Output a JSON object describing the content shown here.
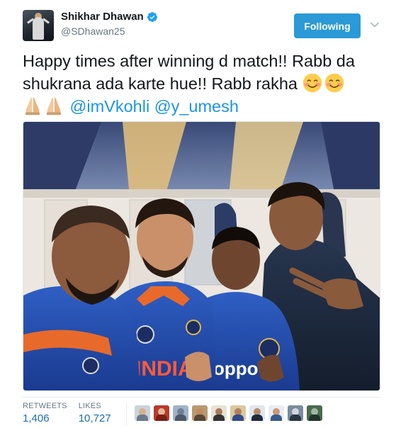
{
  "user": {
    "display_name": "Shikhar Dhawan",
    "handle": "@SDhawan25",
    "verified": true
  },
  "follow_button": {
    "label": "Following"
  },
  "tweet": {
    "line1": "Happy times after winning d match!! Rabb da",
    "line2": "shukrana ada karte hue!! Rabb rakha",
    "mentions": [
      "@imVkohli",
      "@y_umesh"
    ]
  },
  "photo": {
    "shirt_text": "INDIA",
    "sponsor_text": "oppo"
  },
  "stats": {
    "retweets_label": "RETWEETS",
    "retweets_value": "1,406",
    "likes_label": "LIKES",
    "likes_value": "10,727"
  },
  "likers_count_shown": 10,
  "colors": {
    "accent": "#1b95e0",
    "follow_button": "#2b9ad6",
    "verified": "#1da1f2",
    "stat_value": "#1b6ea8"
  }
}
